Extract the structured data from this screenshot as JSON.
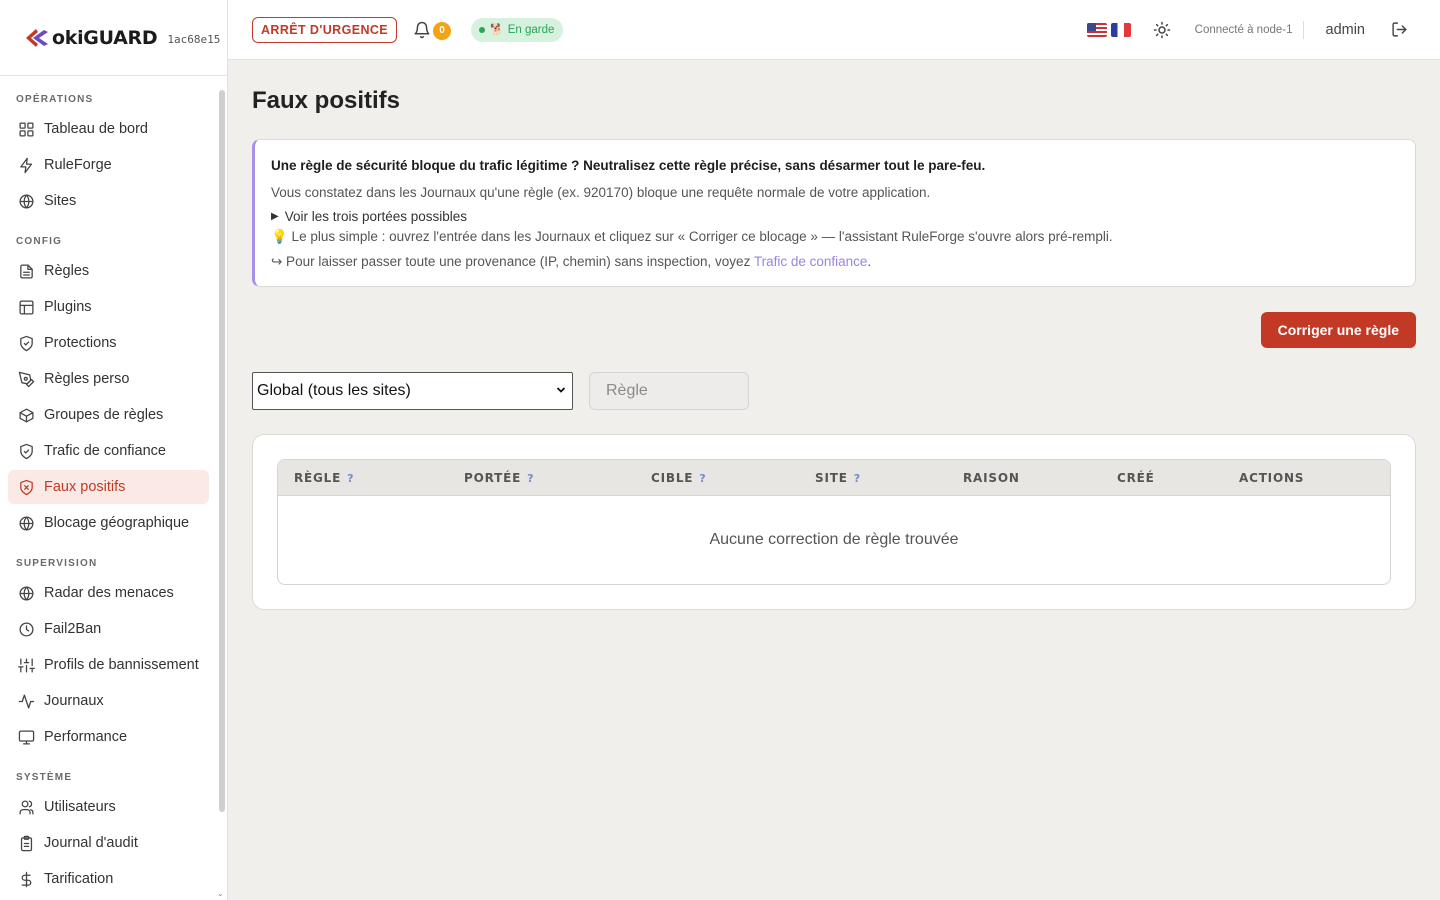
{
  "brand": {
    "name": "okiGUARD",
    "hash": "1ac68e15"
  },
  "sidebar": {
    "sections": [
      {
        "title": "OPÉRATIONS",
        "items": [
          {
            "label": "Tableau de bord",
            "icon": "grid-icon"
          },
          {
            "label": "RuleForge",
            "icon": "bolt-icon"
          },
          {
            "label": "Sites",
            "icon": "globe-icon"
          }
        ]
      },
      {
        "title": "CONFIG",
        "items": [
          {
            "label": "Règles",
            "icon": "file-icon"
          },
          {
            "label": "Plugins",
            "icon": "layout-icon"
          },
          {
            "label": "Protections",
            "icon": "shield-check-icon"
          },
          {
            "label": "Règles perso",
            "icon": "pen-tool-icon"
          },
          {
            "label": "Groupes de règles",
            "icon": "package-icon"
          },
          {
            "label": "Trafic de confiance",
            "icon": "shield-check-icon"
          },
          {
            "label": "Faux positifs",
            "icon": "shield-x-icon",
            "active": true
          },
          {
            "label": "Blocage géographique",
            "icon": "globe-icon"
          }
        ]
      },
      {
        "title": "SUPERVISION",
        "items": [
          {
            "label": "Radar des menaces",
            "icon": "globe-icon"
          },
          {
            "label": "Fail2Ban",
            "icon": "clock-icon"
          },
          {
            "label": "Profils de bannissement",
            "icon": "sliders-icon"
          },
          {
            "label": "Journaux",
            "icon": "activity-icon"
          },
          {
            "label": "Performance",
            "icon": "monitor-icon"
          }
        ]
      },
      {
        "title": "SYSTÈME",
        "items": [
          {
            "label": "Utilisateurs",
            "icon": "users-icon"
          },
          {
            "label": "Journal d'audit",
            "icon": "clipboard-icon"
          },
          {
            "label": "Tarification",
            "icon": "dollar-icon"
          }
        ]
      }
    ]
  },
  "header": {
    "emergency_label": "ARRÊT D'URGENCE",
    "notifications_count": "0",
    "guard_status": "En garde",
    "connected_label": "Connecté à node-1",
    "user": "admin"
  },
  "main": {
    "title": "Faux positifs",
    "info": {
      "lead": "Une règle de sécurité bloque du trafic légitime ? Neutralisez cette règle précise, sans désarmer tout le pare-feu.",
      "p1": "Vous constatez dans les Journaux qu'une règle (ex. 920170) bloque une requête normale de votre application.",
      "details": "Voir les trois portées possibles",
      "tip": "💡 Le plus simple : ouvrez l'entrée dans les Journaux et cliquez sur « Corriger ce blocage » — l'assistant RuleForge s'ouvre alors pré-rempli.",
      "more_prefix": "↪ Pour laisser passer toute une provenance (IP, chemin) sans inspection, voyez ",
      "more_link": "Trafic de confiance",
      "more_suffix": "."
    },
    "fix_button": "Corriger une règle",
    "scope_select": "Global (tous les sites)",
    "rule_placeholder": "Règle",
    "table": {
      "columns": [
        {
          "label": "RÈGLE",
          "help": "?"
        },
        {
          "label": "PORTÉE",
          "help": "?"
        },
        {
          "label": "CIBLE",
          "help": "?"
        },
        {
          "label": "SITE",
          "help": "?"
        },
        {
          "label": "RAISON"
        },
        {
          "label": "CRÉÉ"
        },
        {
          "label": "ACTIONS"
        }
      ],
      "empty": "Aucune correction de règle trouvée"
    }
  },
  "colors": {
    "accent": "#c23a26",
    "link": "#9b84dd",
    "guard": "#2aa455",
    "badge": "#f0a416"
  }
}
